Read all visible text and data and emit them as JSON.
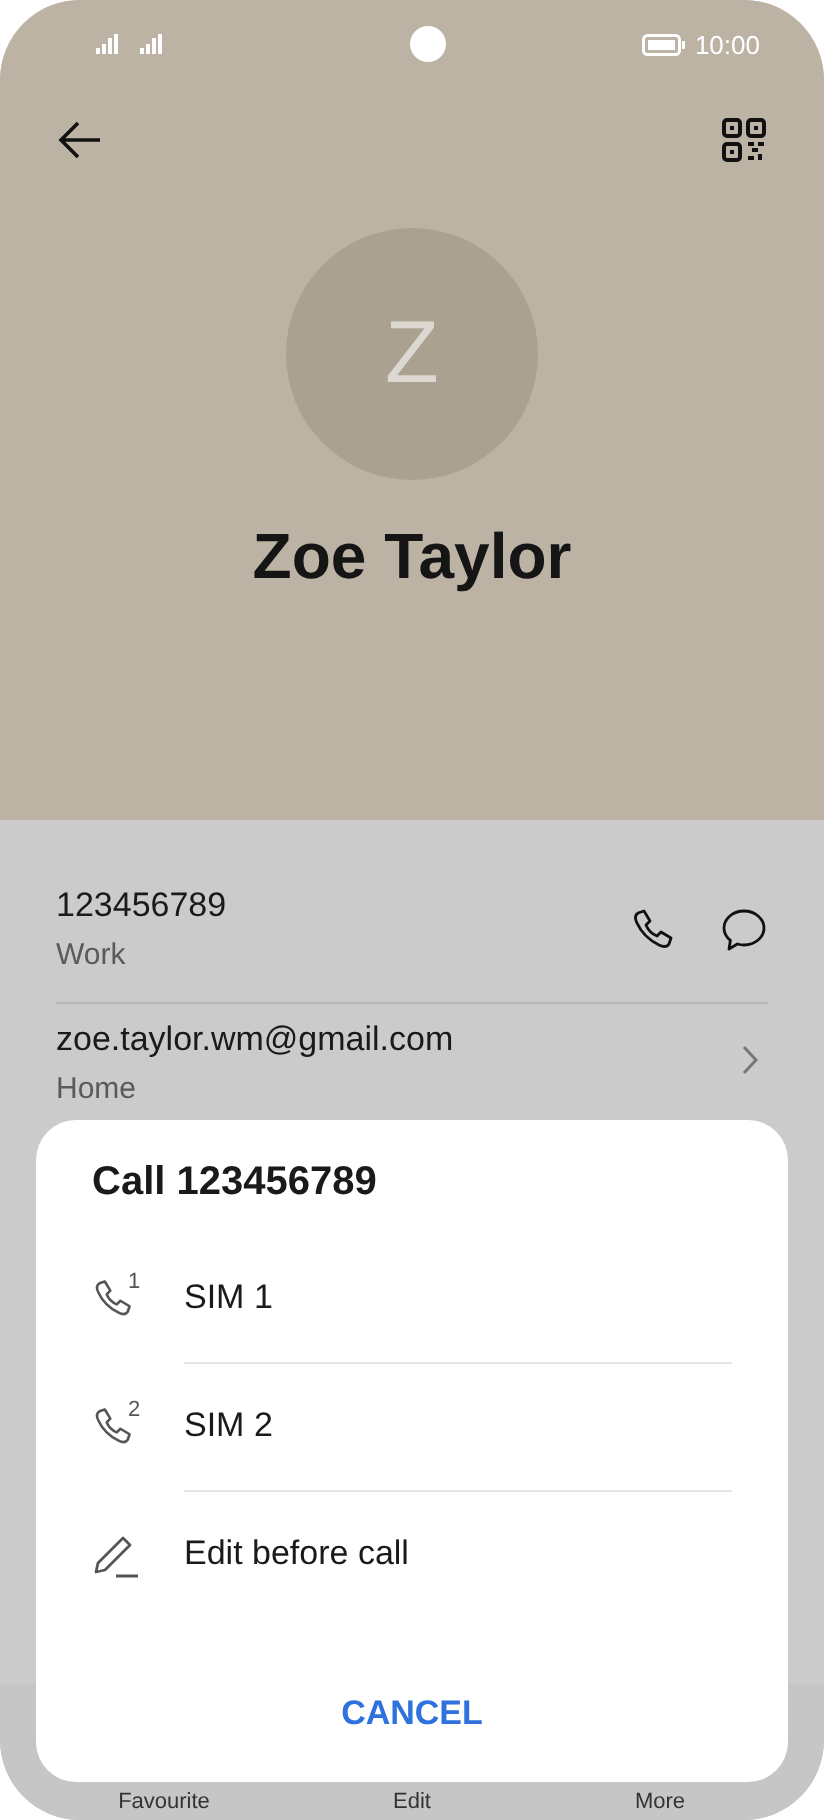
{
  "status_bar": {
    "time": "10:00"
  },
  "contact": {
    "initial": "Z",
    "name": "Zoe Taylor"
  },
  "details": [
    {
      "kind": "phone",
      "value": "123456789",
      "label": "Work"
    },
    {
      "kind": "email",
      "value": "zoe.taylor.wm@gmail.com",
      "label": "Home"
    }
  ],
  "dialog": {
    "title": "Call 123456789",
    "options": [
      {
        "kind": "sim",
        "label": "SIM 1",
        "sim_number": "1"
      },
      {
        "kind": "sim",
        "label": "SIM 2",
        "sim_number": "2"
      },
      {
        "kind": "edit",
        "label": "Edit before call"
      }
    ],
    "cancel": "CANCEL"
  },
  "bottom_nav": [
    "Favourite",
    "Edit",
    "More"
  ]
}
